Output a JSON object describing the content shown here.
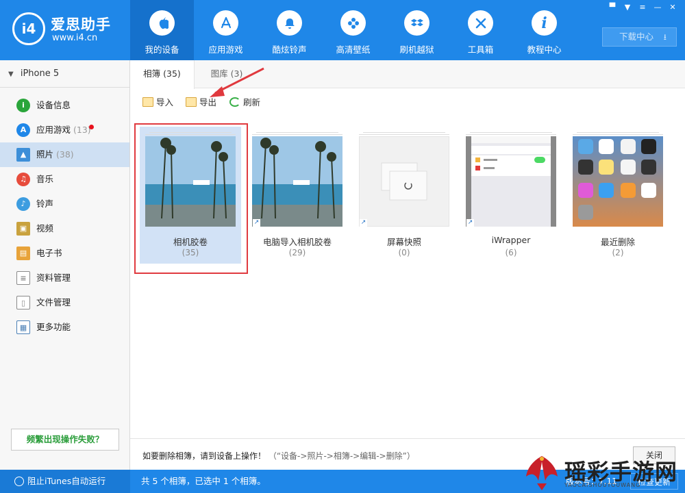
{
  "app": {
    "logo_mark": "i4",
    "name": "爱思助手",
    "url": "www.i4.cn"
  },
  "nav": [
    {
      "label": "我的设备",
      "icon": "apple-icon",
      "active": true
    },
    {
      "label": "应用游戏",
      "icon": "appstore-icon"
    },
    {
      "label": "酷炫铃声",
      "icon": "bell-icon"
    },
    {
      "label": "高清壁纸",
      "icon": "flower-icon"
    },
    {
      "label": "刷机越狱",
      "icon": "dropbox-icon"
    },
    {
      "label": "工具箱",
      "icon": "tools-icon"
    },
    {
      "label": "教程中心",
      "icon": "info-icon"
    }
  ],
  "header": {
    "download_label": "下载中心"
  },
  "sidebar": {
    "device": "iPhone 5",
    "items": [
      {
        "label": "设备信息",
        "icon": "info-circle-icon",
        "color": "#2aa53b"
      },
      {
        "label": "应用游戏",
        "count": "(13)",
        "icon": "appstore-icon",
        "color": "#1f87e8",
        "badge": true
      },
      {
        "label": "照片",
        "count": "(38)",
        "icon": "photo-icon",
        "color": "#3d8fd8",
        "active": true
      },
      {
        "label": "音乐",
        "icon": "music-icon",
        "color": "#e74c3c"
      },
      {
        "label": "铃声",
        "icon": "bell-icon",
        "color": "#3d9de0"
      },
      {
        "label": "视频",
        "icon": "video-icon",
        "color": "#c9a23e"
      },
      {
        "label": "电子书",
        "icon": "book-icon",
        "color": "#e8a33a"
      },
      {
        "label": "资料管理",
        "icon": "contacts-icon",
        "color": "#8a8a8a"
      },
      {
        "label": "文件管理",
        "icon": "file-icon",
        "color": "#8a8a8a"
      },
      {
        "label": "更多功能",
        "icon": "grid-icon",
        "color": "#4a7fb5"
      }
    ],
    "help": "频繁出现操作失败？"
  },
  "tabs": [
    {
      "label": "相簿 (35)",
      "active": true
    },
    {
      "label": "图库 (3)"
    }
  ],
  "toolbar": {
    "import": "导入",
    "export": "导出",
    "refresh": "刷新"
  },
  "albums": [
    {
      "name": "相机胶卷",
      "count": "(35)",
      "selected": true
    },
    {
      "name": "电脑导入相机胶卷",
      "count": "(29)"
    },
    {
      "name": "屏幕快照",
      "count": "(0)"
    },
    {
      "name": "iWrapper",
      "count": "(6)"
    },
    {
      "name": "最近删除",
      "count": "(2)"
    }
  ],
  "notice": {
    "text": "如要删除相簿，请到设备上操作！",
    "hint": "（“设备->照片->相簿->编辑->删除”）",
    "close": "关闭"
  },
  "status": {
    "itunes": "阻止iTunes自动运行",
    "summary": "共 5 个相簿，已选中 1 个相簿。",
    "version": "版本号：7.11",
    "check": "检查更新"
  },
  "watermark": {
    "text": "瑶彩手游网",
    "sub": "YAOCAISHOUYOUWANG"
  }
}
